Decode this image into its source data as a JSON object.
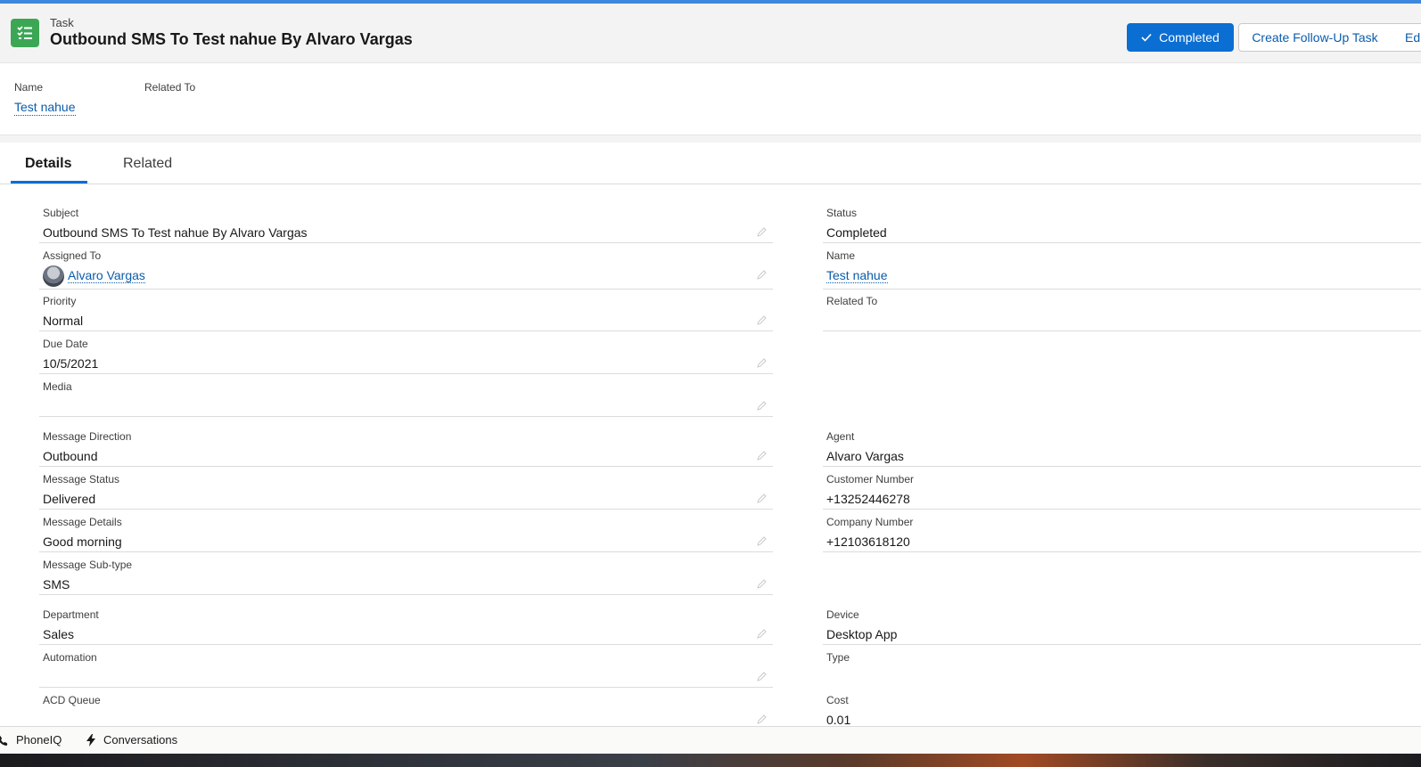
{
  "header": {
    "object_type": "Task",
    "title": "Outbound SMS To Test nahue By Alvaro Vargas",
    "buttons": {
      "completed": "Completed",
      "follow_up": "Create Follow-Up Task",
      "edit": "Ed"
    }
  },
  "highlights": {
    "name_label": "Name",
    "name_value": "Test nahue",
    "related_label": "Related To"
  },
  "tabs": {
    "details": "Details",
    "related": "Related"
  },
  "fields_left": [
    {
      "label": "Subject",
      "value": "Outbound SMS To Test nahue By Alvaro Vargas"
    },
    {
      "label": "Assigned To",
      "value": "Alvaro Vargas"
    },
    {
      "label": "Priority",
      "value": "Normal"
    },
    {
      "label": "Due Date",
      "value": "10/5/2021"
    },
    {
      "label": "Media",
      "value": ""
    },
    {
      "label": "Message Direction",
      "value": "Outbound"
    },
    {
      "label": "Message Status",
      "value": "Delivered"
    },
    {
      "label": "Message Details",
      "value": "Good morning"
    },
    {
      "label": "Message Sub-type",
      "value": "SMS"
    },
    {
      "label": "Department",
      "value": "Sales"
    },
    {
      "label": "Automation",
      "value": ""
    },
    {
      "label": "ACD Queue",
      "value": ""
    }
  ],
  "fields_right": [
    {
      "label": "Status",
      "value": "Completed"
    },
    {
      "label": "Name",
      "value": "Test nahue"
    },
    {
      "label": "Related To",
      "value": ""
    },
    {
      "label": "Agent",
      "value": "Alvaro Vargas"
    },
    {
      "label": "Customer Number",
      "value": "+13252446278"
    },
    {
      "label": "Company Number",
      "value": "+12103618120"
    },
    {
      "label": "Device",
      "value": "Desktop App"
    },
    {
      "label": "Type",
      "value": ""
    },
    {
      "label": "Cost",
      "value": "0.01"
    }
  ],
  "footer": {
    "phoneiq": "PhoneIQ",
    "conversations": "Conversations"
  },
  "colors": {
    "brand_blue": "#0b6ed3",
    "link_blue": "#0b5cab",
    "task_icon_green": "#3ba755"
  }
}
